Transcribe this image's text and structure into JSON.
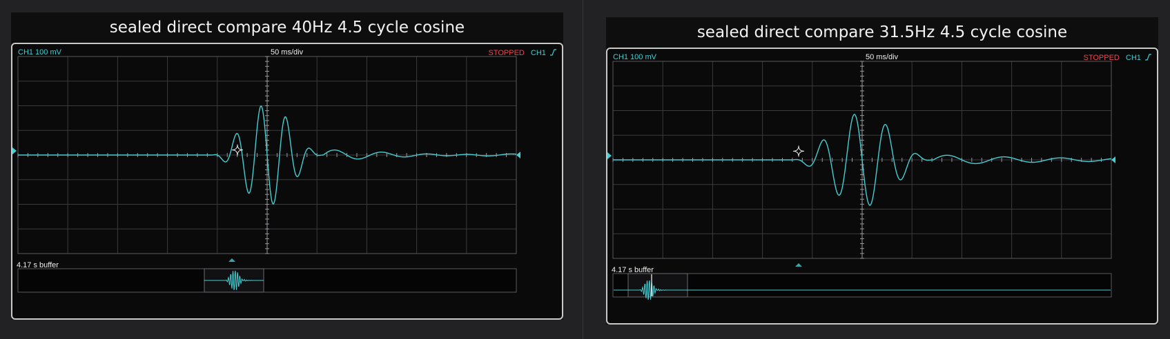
{
  "colors": {
    "trace": "#45cfd3",
    "stopped": "#f2444c",
    "frame": "#c9c9c9"
  },
  "panels": [
    {
      "title": "sealed direct compare 40Hz 4.5 cycle cosine",
      "channel_label": "CH1 100 mV",
      "timebase": "50 ms/div",
      "status": "STOPPED",
      "trigger_channel": "CH1",
      "trigger_icon": "rising-edge-icon",
      "buffer_label": "4.17 s buffer",
      "frequency_hz": 40,
      "cycles": 4.5
    },
    {
      "title": "sealed direct compare 31.5Hz 4.5 cycle cosine",
      "channel_label": "CH1 100 mV",
      "timebase": "50 ms/div",
      "status": "STOPPED",
      "trigger_channel": "CH1",
      "trigger_icon": "rising-edge-icon",
      "buffer_label": "4.17 s buffer",
      "frequency_hz": 31.5,
      "cycles": 4.5
    }
  ]
}
